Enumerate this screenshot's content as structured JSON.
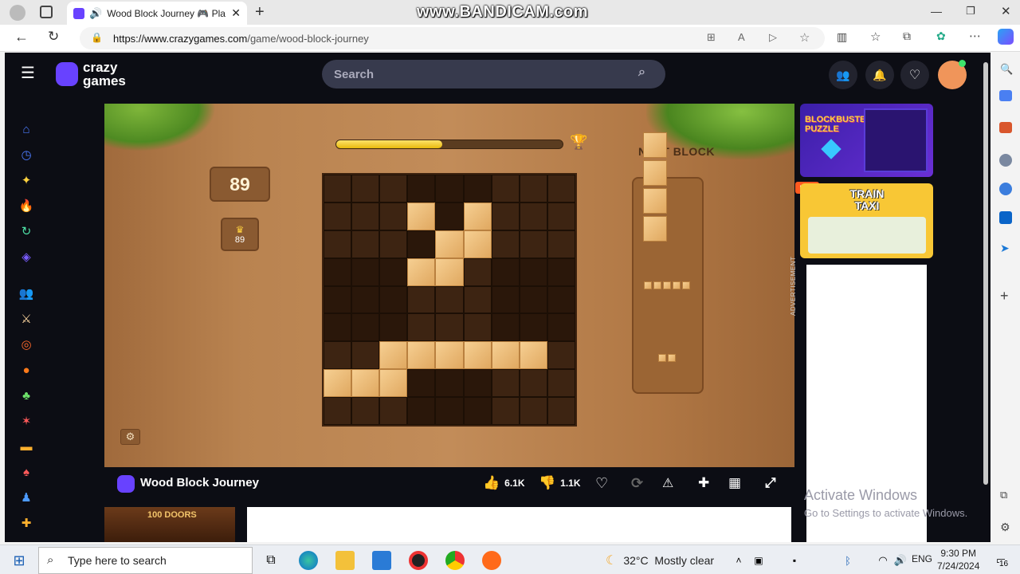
{
  "browser": {
    "tab_title": "Wood Block Journey 🎮 Pla",
    "watermark": "www.BANDICAM.com",
    "url_host": "https://www.crazygames.com",
    "url_path": "/game/wood-block-journey"
  },
  "site": {
    "logo_top": "crazy",
    "logo_bottom": "games",
    "search_placeholder": "Search"
  },
  "game": {
    "score": "89",
    "best_score": "89",
    "next_block_label": "NEXT BLOCK",
    "progress_fraction": 0.47,
    "board": [
      [
        0,
        0,
        0,
        0,
        0,
        0,
        0,
        0,
        0
      ],
      [
        0,
        0,
        0,
        1,
        0,
        1,
        0,
        0,
        0
      ],
      [
        0,
        0,
        0,
        0,
        1,
        1,
        0,
        0,
        0
      ],
      [
        0,
        0,
        0,
        1,
        1,
        0,
        0,
        0,
        0
      ],
      [
        0,
        0,
        0,
        0,
        0,
        0,
        0,
        0,
        0
      ],
      [
        0,
        0,
        0,
        0,
        0,
        0,
        0,
        0,
        0
      ],
      [
        0,
        0,
        1,
        1,
        1,
        1,
        1,
        1,
        0
      ],
      [
        1,
        1,
        1,
        0,
        0,
        0,
        0,
        0,
        0
      ],
      [
        0,
        0,
        0,
        0,
        0,
        0,
        0,
        0,
        0
      ]
    ]
  },
  "gamebar": {
    "title": "Wood Block Journey",
    "likes": "6.1K",
    "dislikes": "1.1K"
  },
  "ads": {
    "ad1_title": "BLOCKBUSTER PUZZLE",
    "hot_badge": "HOT",
    "ad2_title": "TRAIN TAXI",
    "advertisement_label": "ADVERTISEMENT",
    "thumb_title": "100 DOORS"
  },
  "windows": {
    "activate_title": "Activate Windows",
    "activate_sub": "Go to Settings to activate Windows.",
    "search_placeholder": "Type here to search",
    "weather": "32°C  Mostly clear",
    "language": "ENG",
    "time": "9:30 PM",
    "date": "7/24/2024",
    "notification_count": "16"
  }
}
